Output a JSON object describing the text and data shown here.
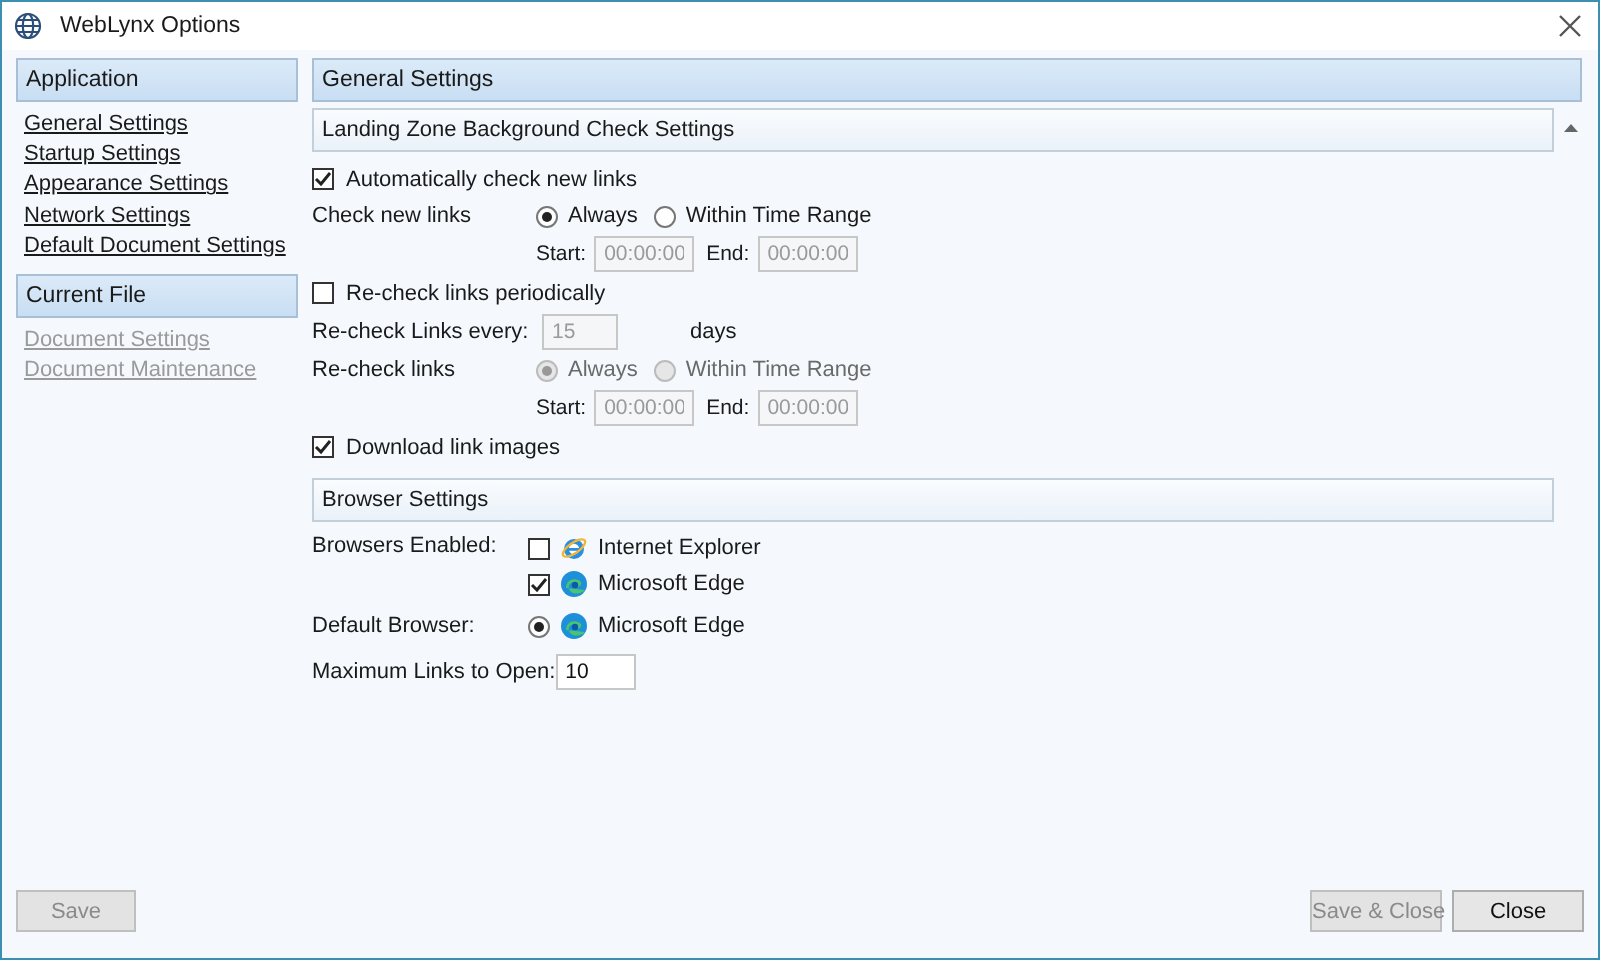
{
  "window": {
    "title": "WebLynx Options"
  },
  "sidebar": {
    "groups": [
      {
        "title": "Application",
        "items": [
          {
            "label": "General Settings",
            "disabled": false
          },
          {
            "label": "Startup Settings",
            "disabled": false
          },
          {
            "label": "Appearance Settings",
            "disabled": false
          },
          {
            "label": "Network Settings",
            "disabled": false
          },
          {
            "label": "Default Document Settings",
            "disabled": false
          }
        ]
      },
      {
        "title": "Current File",
        "items": [
          {
            "label": "Document Settings",
            "disabled": true
          },
          {
            "label": "Document Maintenance",
            "disabled": true
          }
        ]
      }
    ]
  },
  "main": {
    "header": "General Settings",
    "sections": [
      {
        "title": "Landing Zone Background Check Settings",
        "rows": [
          {
            "kind": "checkbox",
            "label": "Automatically check new links",
            "checked": true
          },
          {
            "kind": "radios",
            "label": "Check new links",
            "disabled": false,
            "options": [
              {
                "label": "Always",
                "selected": true
              },
              {
                "label": "Within Time Range",
                "selected": false
              }
            ]
          },
          {
            "kind": "timerange",
            "disabled": true,
            "start": {
              "label": "Start:",
              "value": "00:00:00"
            },
            "end": {
              "label": "End:",
              "value": "00:00:00"
            }
          },
          {
            "kind": "checkbox",
            "label": "Re-check links periodically",
            "checked": false
          },
          {
            "kind": "number",
            "label": "Re-check Links every:",
            "value": "15",
            "unit": "days",
            "disabled": true
          },
          {
            "kind": "radios",
            "label": "Re-check links",
            "disabled": true,
            "options": [
              {
                "label": "Always",
                "selected": true
              },
              {
                "label": "Within Time Range",
                "selected": false
              }
            ]
          },
          {
            "kind": "timerange",
            "disabled": true,
            "start": {
              "label": "Start:",
              "value": "00:00:00"
            },
            "end": {
              "label": "End:",
              "value": "00:00:00"
            }
          },
          {
            "kind": "checkbox",
            "label": "Download link images",
            "checked": true
          }
        ]
      },
      {
        "title": "Browser Settings",
        "rows": [
          {
            "kind": "browser-checks",
            "label": "Browsers Enabled:",
            "options": [
              {
                "label": "Internet Explorer",
                "kind": "ie",
                "checked": false
              },
              {
                "label": "Microsoft Edge",
                "kind": "edge",
                "checked": true
              }
            ]
          },
          {
            "kind": "browser-radios",
            "label": "Default Browser:",
            "options": [
              {
                "label": "Microsoft Edge",
                "kind": "edge",
                "selected": true
              }
            ]
          },
          {
            "kind": "number-inline",
            "label": "Maximum Links to Open:",
            "value": "10",
            "disabled": false
          }
        ]
      }
    ]
  },
  "buttons": [
    {
      "label": "Save",
      "disabled": true
    },
    {
      "label": "Save & Close",
      "disabled": true
    },
    {
      "label": "Close",
      "disabled": false
    }
  ]
}
